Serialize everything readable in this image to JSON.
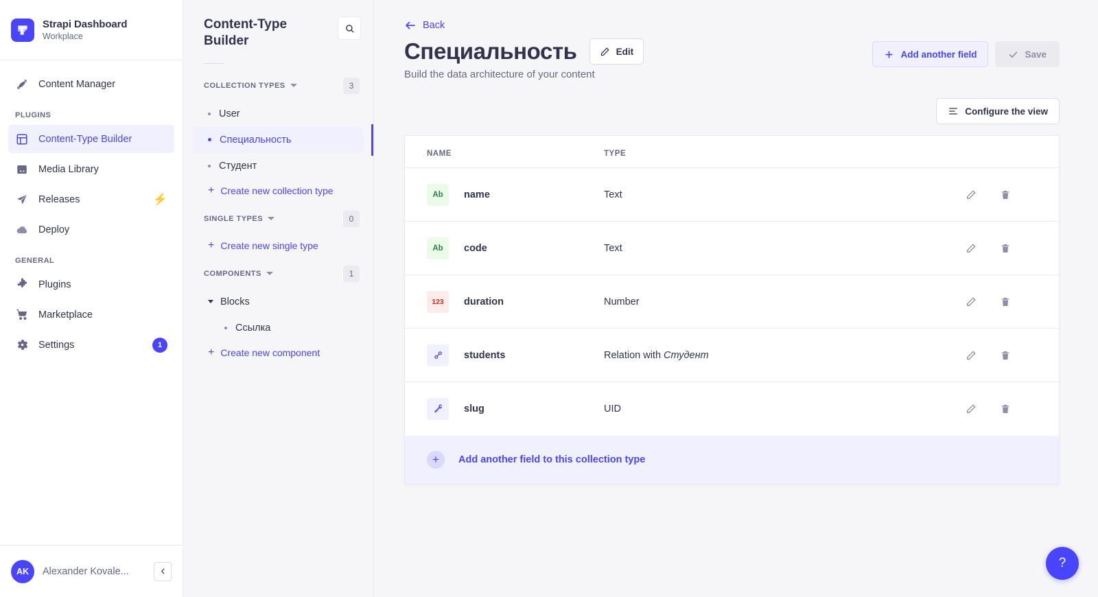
{
  "sidebar": {
    "brand": {
      "title": "Strapi Dashboard",
      "subtitle": "Workplace",
      "logo_icon": "strapi-logo-icon"
    },
    "top_items": [
      {
        "label": "Content Manager",
        "icon": "feather-icon",
        "active": false
      }
    ],
    "sections": [
      {
        "label": "PLUGINS",
        "items": [
          {
            "label": "Content-Type Builder",
            "icon": "layout-icon",
            "active": true
          },
          {
            "label": "Media Library",
            "icon": "image-icon",
            "active": false
          },
          {
            "label": "Releases",
            "icon": "paper-plane-icon",
            "active": false,
            "trailing": "bolt"
          },
          {
            "label": "Deploy",
            "icon": "cloud-icon",
            "active": false
          }
        ]
      },
      {
        "label": "GENERAL",
        "items": [
          {
            "label": "Plugins",
            "icon": "puzzle-icon",
            "active": false
          },
          {
            "label": "Marketplace",
            "icon": "shopping-cart-icon",
            "active": false
          },
          {
            "label": "Settings",
            "icon": "gear-icon",
            "active": false,
            "badge": "1"
          }
        ]
      }
    ],
    "footer": {
      "avatar_initials": "AK",
      "user_name": "Alexander Kovale...",
      "collapse_icon": "chevron-left-icon"
    }
  },
  "subnav": {
    "title": "Content-Type Builder",
    "search_icon": "search-icon",
    "groups": [
      {
        "label": "COLLECTION TYPES",
        "count": "3",
        "items": [
          {
            "label": "User",
            "active": false
          },
          {
            "label": "Специальность",
            "active": true
          },
          {
            "label": "Студент",
            "active": false
          }
        ],
        "create_label": "Create new collection type"
      },
      {
        "label": "SINGLE TYPES",
        "count": "0",
        "items": [],
        "create_label": "Create new single type"
      },
      {
        "label": "COMPONENTS",
        "count": "1",
        "group_item": {
          "label": "Blocks",
          "children": [
            {
              "label": "Ссылка"
            }
          ]
        },
        "items": [],
        "create_label": "Create new component"
      }
    ]
  },
  "main": {
    "back_label": "Back",
    "back_icon": "arrow-left-icon",
    "page_title": "Специальность",
    "page_subtitle": "Build the data architecture of your content",
    "edit_button": {
      "label": "Edit",
      "icon": "pencil-icon"
    },
    "add_field_button": {
      "label": "Add another field",
      "icon": "plus-icon"
    },
    "save_button": {
      "label": "Save",
      "icon": "check-icon"
    },
    "configure_button": {
      "label": "Configure the view",
      "icon": "sliders-icon"
    },
    "table": {
      "columns": [
        "NAME",
        "TYPE"
      ],
      "rows": [
        {
          "icon_label": "Ab",
          "icon_kind": "ti-text",
          "icon_name": "text-type-icon",
          "name": "name",
          "type": "Text",
          "type_em": ""
        },
        {
          "icon_label": "Ab",
          "icon_kind": "ti-text",
          "icon_name": "text-type-icon",
          "name": "code",
          "type": "Text",
          "type_em": ""
        },
        {
          "icon_label": "123",
          "icon_kind": "ti-number",
          "icon_name": "number-type-icon",
          "name": "duration",
          "type": "Number",
          "type_em": ""
        },
        {
          "icon_label": "",
          "icon_kind": "ti-relation",
          "icon_name": "relation-type-icon",
          "name": "students",
          "type": "Relation with ",
          "type_em": "Студент"
        },
        {
          "icon_label": "",
          "icon_kind": "ti-uid",
          "icon_name": "uid-type-icon",
          "name": "slug",
          "type": "UID",
          "type_em": ""
        }
      ],
      "row_actions": {
        "edit_icon": "pencil-icon",
        "delete_icon": "trash-icon"
      }
    },
    "add_field_bar": {
      "label": "Add another field to this collection type",
      "icon": "plus-icon"
    },
    "help_button": {
      "label": "?",
      "icon": "question-mark-icon"
    }
  },
  "colors": {
    "accent": "#4945ff",
    "accent_light": "#f0f0ff",
    "text": "#32324d",
    "muted": "#666687",
    "bg": "#f6f6f9",
    "green": "#328048",
    "red": "#d02b20",
    "orange": "#f29d41"
  }
}
